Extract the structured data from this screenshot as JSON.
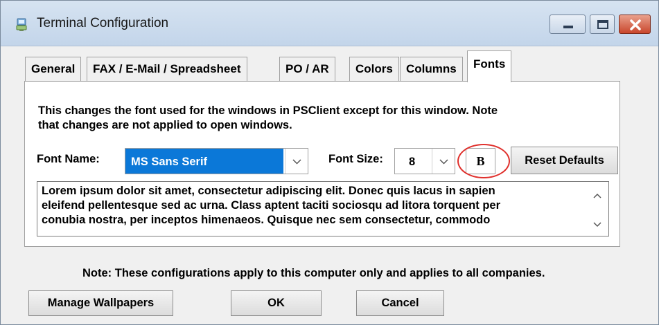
{
  "window": {
    "title": "Terminal Configuration",
    "icon": "terminal-app-icon",
    "controls": [
      "minimize-icon",
      "maximize-icon",
      "close-icon"
    ]
  },
  "tabs": [
    {
      "label": "General",
      "active": false
    },
    {
      "label": "FAX / E-Mail / Spreadsheet",
      "active": false
    },
    {
      "label": "PO / AR",
      "active": false
    },
    {
      "label": "Colors",
      "active": false
    },
    {
      "label": "Columns",
      "active": false
    },
    {
      "label": "Fonts",
      "active": true
    }
  ],
  "fonts_tab": {
    "description_line1": "This changes the font used for the windows in PSClient except for this window.  Note",
    "description_line2": "that changes are not applied to open windows.",
    "font_name_label": "Font Name:",
    "font_name_value": "MS Sans Serif",
    "font_size_label": "Font Size:",
    "font_size_value": "8",
    "bold_button_label": "B",
    "reset_defaults_label": "Reset Defaults",
    "preview_lines": [
      "Lorem ipsum dolor sit amet, consectetur adipiscing elit. Donec quis lacus in sapien",
      "eleifend pellentesque sed ac urna. Class aptent taciti sociosqu ad litora torquent per",
      "conubia nostra, per inceptos himenaeos. Quisque nec sem consectetur, commodo"
    ]
  },
  "footer": {
    "note": "Note: These configurations apply to this computer only and applies to all companies.",
    "manage_wallpapers_label": "Manage Wallpapers",
    "ok_label": "OK",
    "cancel_label": "Cancel"
  },
  "colors": {
    "selection_highlight": "#0b78d8",
    "annotation_ring": "#e0302c",
    "close_button": "#c9462c"
  }
}
